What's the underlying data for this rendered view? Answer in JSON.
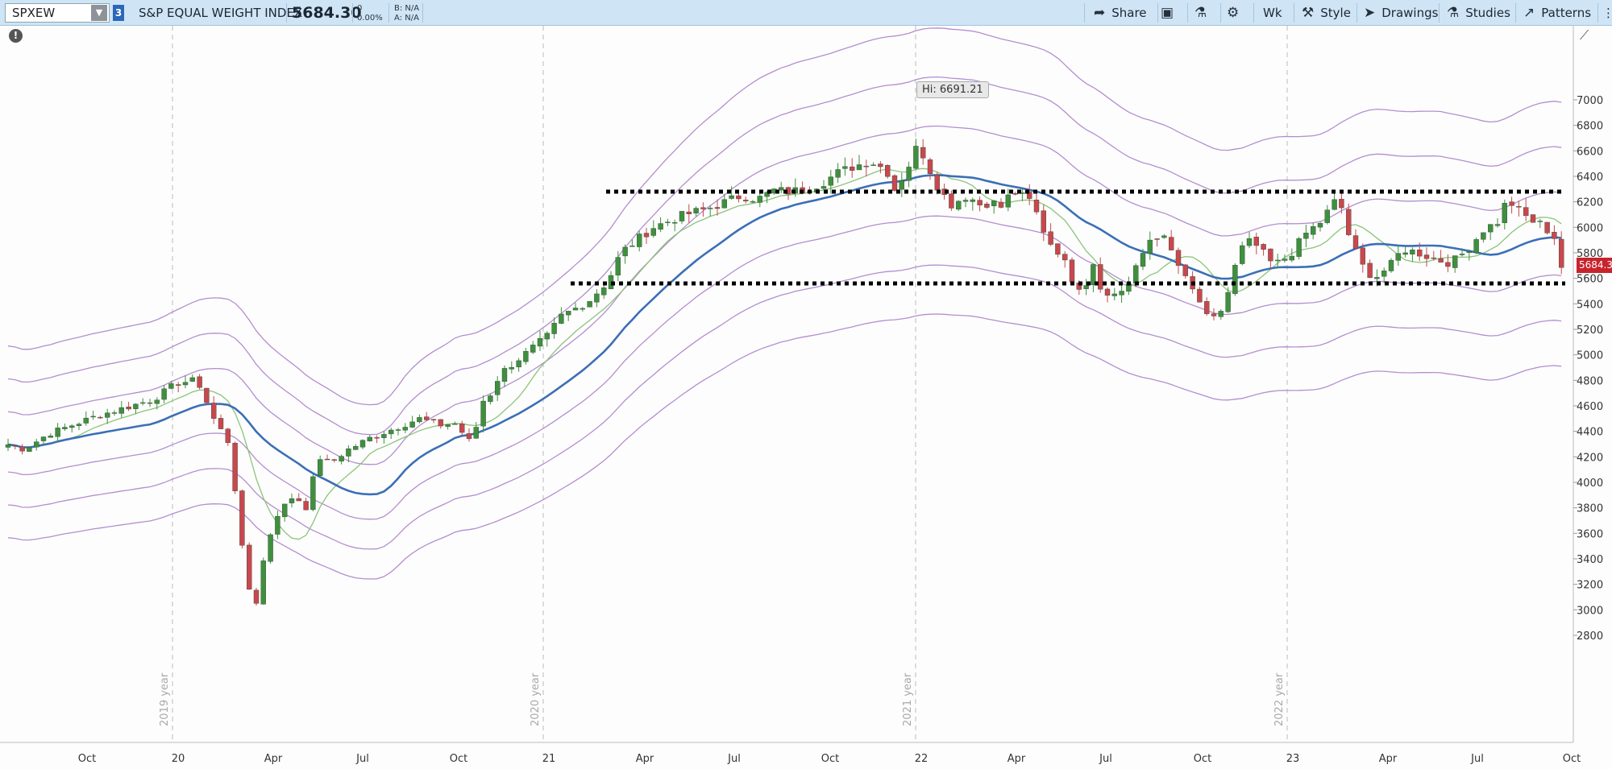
{
  "toolbar": {
    "symbol": "SPXEW",
    "link_group": "3",
    "description": "S&P EQUAL WEIGHT INDEX",
    "last_price": "5684.30",
    "change": "0",
    "change_pct": "0.00%",
    "bid": "B: N/A",
    "ask": "A: N/A",
    "share_label": "Share",
    "timeframe_label": "Wk",
    "style_label": "Style",
    "drawings_label": "Drawings",
    "studies_label": "Studies",
    "patterns_label": "Patterns"
  },
  "chart": {
    "high_annotation": "Hi: 6691.21",
    "last_price_tag": "5684.3"
  },
  "chart_data": {
    "type": "candlestick",
    "symbol": "SPXEW",
    "ylim": [
      2750,
      7100
    ],
    "y_ticks": [
      2800,
      3000,
      3200,
      3400,
      3600,
      3800,
      4000,
      4200,
      4400,
      4600,
      4800,
      5000,
      5200,
      5400,
      5600,
      5800,
      6000,
      6200,
      6400,
      6600,
      6800,
      7000
    ],
    "x_tick_labels": [
      "Oct",
      "20",
      "Apr",
      "Jul",
      "Oct",
      "21",
      "Apr",
      "Jul",
      "Oct",
      "22",
      "Apr",
      "Jul",
      "Oct",
      "23",
      "Apr",
      "Jul",
      "Oct"
    ],
    "year_separator_labels": [
      "2019 year",
      "2020 year",
      "2021 year",
      "2022 year"
    ],
    "horizontal_lines": [
      6280,
      5560
    ],
    "high": 6691.21,
    "last": 5684.3,
    "colors": {
      "up": "#3f8f3f",
      "down": "#c9474f",
      "ma_center": "#3b6fb6",
      "ma_fast": "#8bc47a",
      "bands": "#b48ed0"
    }
  }
}
